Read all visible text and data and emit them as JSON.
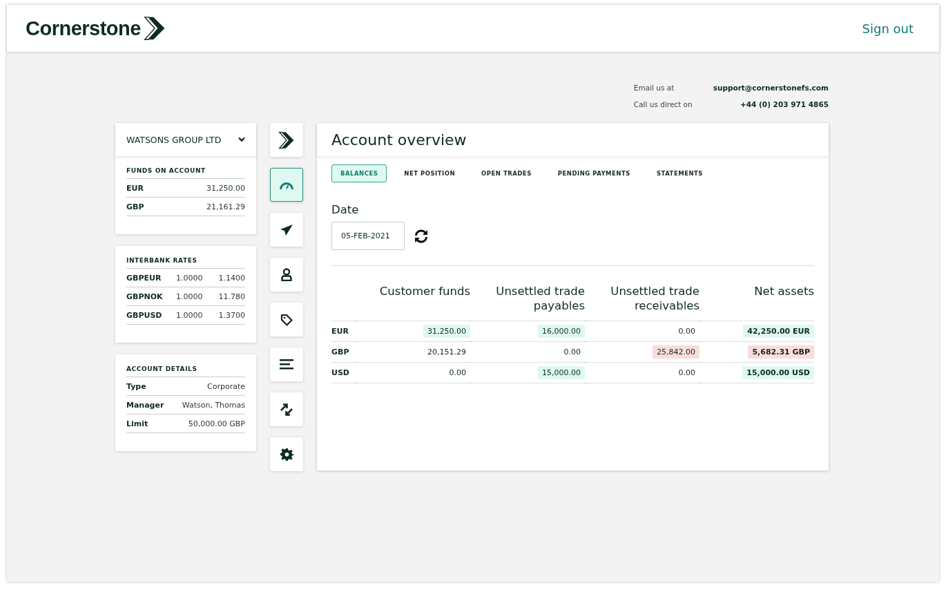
{
  "header": {
    "brand": "Cornerstone",
    "sign_out": "Sign out"
  },
  "contact": [
    {
      "label": "Email us at",
      "value": "support@cornerstonefs.com"
    },
    {
      "label": "Call us direct on",
      "value": "+44 (0) 203 971 4865"
    }
  ],
  "account_selector": {
    "value": "WATSONS GROUP LTD"
  },
  "funds": {
    "title": "FUNDS ON ACCOUNT",
    "rows": [
      {
        "currency": "EUR",
        "amount": "31,250.00"
      },
      {
        "currency": "GBP",
        "amount": "21,161.29"
      }
    ]
  },
  "rates": {
    "title": "INTERBANK RATES",
    "rows": [
      {
        "pair": "GBPEUR",
        "base": "1.0000",
        "rate": "1.1400"
      },
      {
        "pair": "GBPNOK",
        "base": "1.0000",
        "rate": "11.780"
      },
      {
        "pair": "GBPUSD",
        "base": "1.0000",
        "rate": "1.3700"
      }
    ]
  },
  "details": {
    "title": "ACCOUNT DETAILS",
    "rows": [
      {
        "label": "Type",
        "value": "Corporate"
      },
      {
        "label": "Manager",
        "value": "Watson, Thomas"
      },
      {
        "label": "Limit",
        "value": "50,000.00 GBP"
      }
    ]
  },
  "nav": [
    {
      "kind": "logo",
      "selected": false
    },
    {
      "kind": "dashboard",
      "selected": true
    },
    {
      "kind": "send",
      "selected": false
    },
    {
      "kind": "person",
      "selected": false
    },
    {
      "kind": "tag",
      "selected": false
    },
    {
      "kind": "list",
      "selected": false
    },
    {
      "kind": "exchange",
      "selected": false
    },
    {
      "kind": "settings",
      "selected": false
    }
  ],
  "main": {
    "title": "Account overview",
    "tabs": [
      {
        "label": "BALANCES",
        "selected": true
      },
      {
        "label": "NET POSITION",
        "selected": false
      },
      {
        "label": "OPEN TRADES",
        "selected": false
      },
      {
        "label": "PENDING PAYMENTS",
        "selected": false
      },
      {
        "label": "STATEMENTS",
        "selected": false
      }
    ],
    "date_label": "Date",
    "date_value": "05-FEB-2021",
    "table": {
      "columns": [
        "Customer funds",
        "Unsettled trade payables",
        "Unsettled trade receivables",
        "Net assets"
      ],
      "rows": [
        {
          "currency": "EUR",
          "cells": [
            {
              "text": "31,250.00",
              "color": "#def9f0"
            },
            {
              "text": "16,000.00",
              "color": "#def9f0"
            },
            {
              "text": "0.00"
            },
            {
              "text": "42,250.00 EUR",
              "color": "#def9f0"
            }
          ]
        },
        {
          "currency": "GBP",
          "cells": [
            {
              "text": "20,151.29"
            },
            {
              "text": "0.00"
            },
            {
              "text": "25,842.00",
              "color": "#fbdcdc"
            },
            {
              "text": "5,682.31 GBP",
              "color": "#fbdcdc"
            }
          ]
        },
        {
          "currency": "USD",
          "cells": [
            {
              "text": "0.00"
            },
            {
              "text": "15,000.00",
              "color": "#def9f0"
            },
            {
              "text": "0.00"
            },
            {
              "text": "15,000.00 USD",
              "color": "#def9f0"
            }
          ]
        }
      ]
    }
  }
}
